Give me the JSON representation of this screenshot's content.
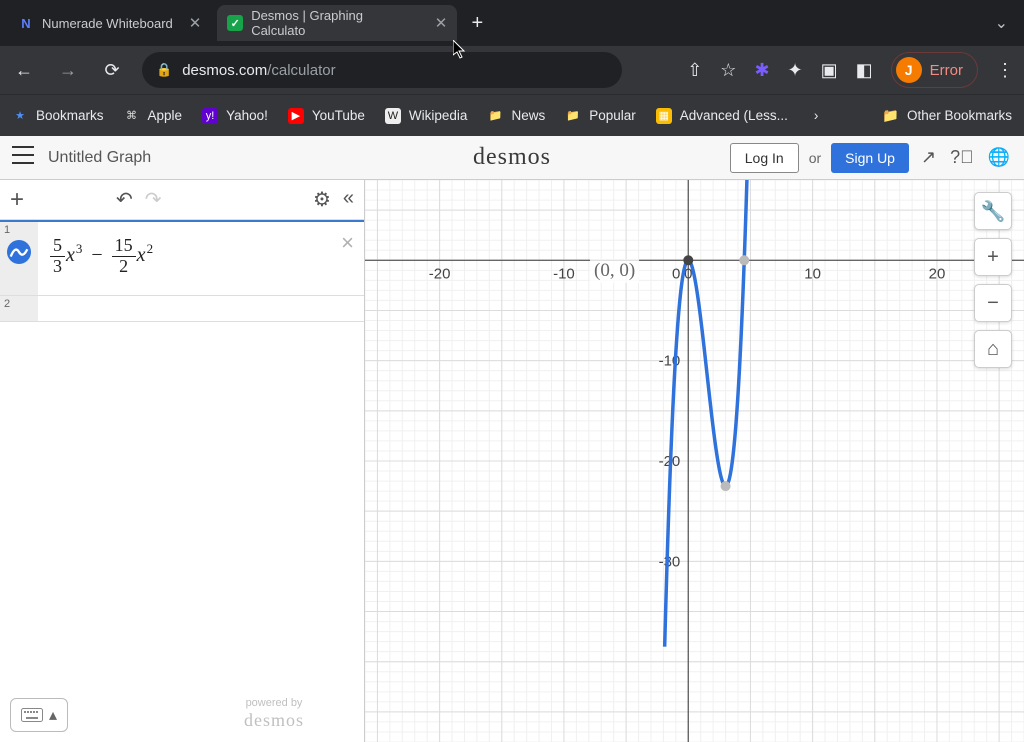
{
  "browser": {
    "tabs": [
      {
        "label": "Numerade Whiteboard",
        "favicon": "N"
      },
      {
        "label": "Desmos | Graphing Calculato",
        "favicon": "D"
      }
    ],
    "url_domain": "desmos.com",
    "url_path": "/calculator",
    "profile": {
      "initial": "J",
      "label": "Error"
    },
    "bookmarks": [
      {
        "label": "Bookmarks"
      },
      {
        "label": "Apple"
      },
      {
        "label": "Yahoo!"
      },
      {
        "label": "YouTube"
      },
      {
        "label": "Wikipedia"
      },
      {
        "label": "News"
      },
      {
        "label": "Popular"
      },
      {
        "label": "Advanced (Less..."
      }
    ],
    "other_bookmarks": "Other Bookmarks"
  },
  "desmos": {
    "title": "Untitled Graph",
    "logo": "desmos",
    "login": "Log In",
    "or": "or",
    "signup": "Sign Up",
    "expressions": {
      "row1": {
        "index": "1",
        "frac1_num": "5",
        "frac1_den": "3",
        "var1": "x",
        "exp1": "3",
        "minus": "−",
        "frac2_num": "15",
        "frac2_den": "2",
        "var2": "x",
        "exp2": "2"
      },
      "row2_index": "2"
    },
    "powered_top": "powered by",
    "powered_logo": "desmos"
  },
  "chart_data": {
    "type": "line",
    "title": "",
    "xlabel": "",
    "ylabel": "",
    "xlim": [
      -26,
      27
    ],
    "ylim": [
      -48,
      8
    ],
    "x_ticks": [
      -20,
      -10,
      0,
      10,
      20
    ],
    "y_ticks": [
      -10,
      -20,
      -30
    ],
    "point_label": "(0, 0)",
    "series": [
      {
        "name": "5/3 x^3 - 15/2 x^2",
        "x": [
          4.67,
          4.3,
          4.0,
          3.5,
          3.0,
          2.5,
          2.0,
          1.5,
          1.0,
          0.5,
          0.0,
          -0.3,
          -0.6,
          -0.9,
          -1.1,
          -1.3,
          -1.5
        ],
        "y": [
          6.0,
          -6.1,
          -13.3,
          -20.4,
          -22.5,
          -20.8,
          -16.7,
          -11.2,
          -5.8,
          -1.67,
          0.0,
          -0.72,
          -3.06,
          -7.29,
          -11.3,
          -16.3,
          -22.5
        ]
      }
    ],
    "marked_points": [
      {
        "x": 0,
        "y": 0,
        "style": "solid"
      },
      {
        "x": 3,
        "y": -22.5,
        "style": "hollow"
      },
      {
        "x": 4.5,
        "y": 0,
        "style": "hollow"
      }
    ]
  }
}
